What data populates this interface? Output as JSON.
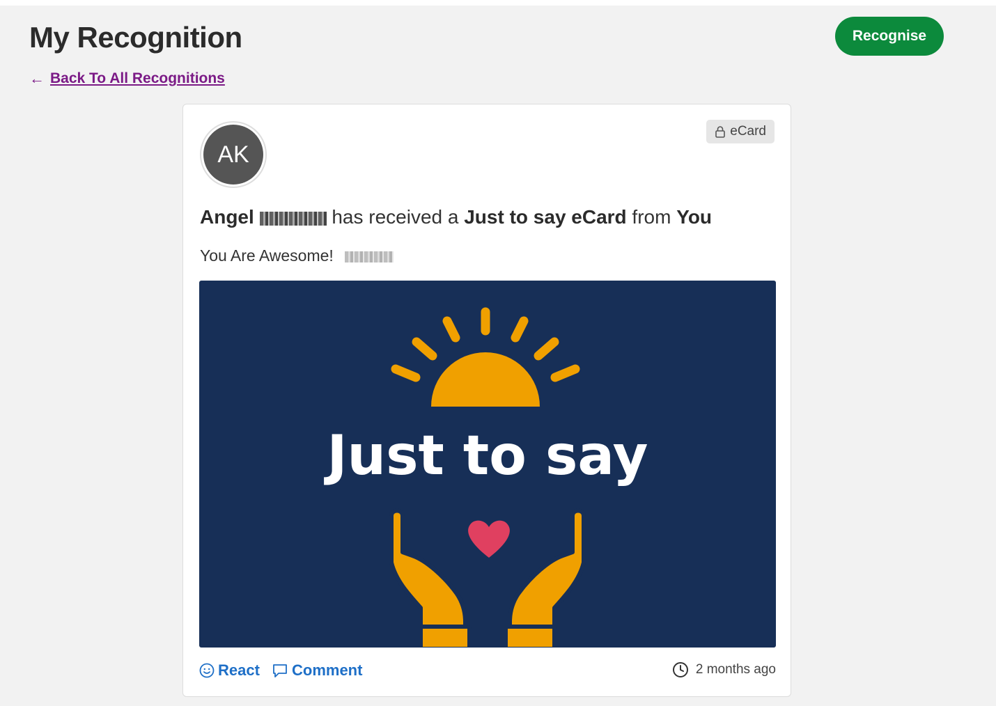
{
  "header": {
    "title": "My Recognition",
    "recognise_label": "Recognise",
    "back_label": "Back To All Recognitions",
    "back_arrow": "←"
  },
  "card": {
    "avatar_initials": "AK",
    "badge_label": "eCard",
    "headline": {
      "recipient_first": "Angel",
      "middle": " has received a ",
      "card_name": "Just to say eCard",
      "from_word": " from ",
      "sender": "You"
    },
    "message": "You Are Awesome!",
    "image_text": "Just to say",
    "react_label": "React",
    "comment_label": "Comment",
    "time_ago": "2 months ago"
  },
  "colors": {
    "accent_green": "#0c8a3c",
    "link_purple": "#7b1a86",
    "action_blue": "#1e6fc7",
    "ecard_navy": "#172f57",
    "ecard_orange": "#f0a000",
    "heart_red": "#e04060"
  },
  "icons": {
    "back": "arrow-left-icon",
    "lock": "lock-icon",
    "react": "smiley-icon",
    "comment": "speech-bubble-icon",
    "time": "clock-icon"
  }
}
